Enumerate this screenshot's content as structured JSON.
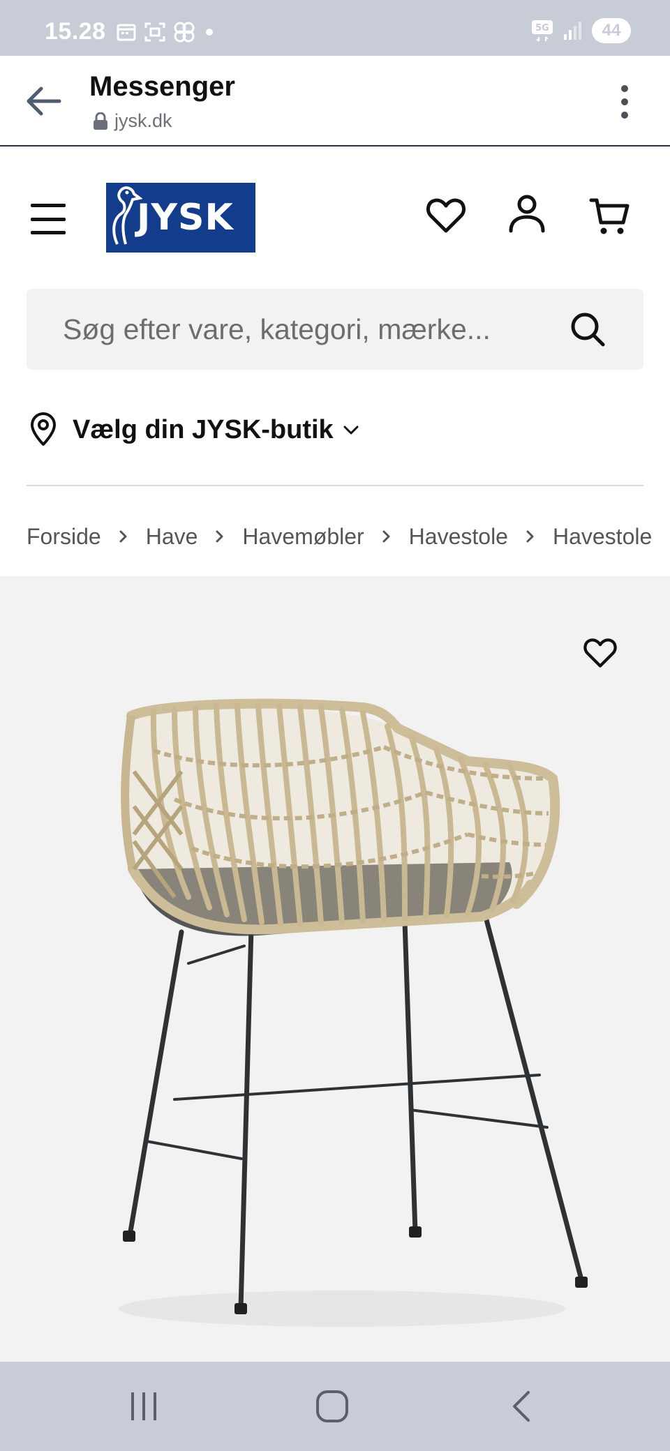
{
  "status_bar": {
    "time": "15.28",
    "network": "5G",
    "battery": "44",
    "icons": [
      "calendar-icon",
      "screenshot-icon",
      "pinwheel-icon",
      "dot-icon",
      "signal-icon"
    ]
  },
  "tab_header": {
    "title": "Messenger",
    "url": "jysk.dk",
    "icons": [
      "back-arrow-icon",
      "lock-icon",
      "more-vert-icon"
    ]
  },
  "site_header": {
    "logo_text": "JYSK",
    "brand_color": "#143c8c",
    "icons": [
      "menu-icon",
      "heart-icon",
      "user-icon",
      "cart-icon"
    ]
  },
  "search": {
    "placeholder": "Søg efter vare, kategori, mærke..."
  },
  "store": {
    "label": "Vælg din JYSK-butik"
  },
  "breadcrumb": {
    "items": [
      "Forside",
      "Have",
      "Havemøbler",
      "Havestole",
      "Havestole"
    ]
  },
  "product": {
    "image_alt": "Rattan havestol med sorte metalben",
    "icons": [
      "wishlist-heart-icon"
    ]
  },
  "nav_bar": {
    "icons": [
      "recent-apps-icon",
      "home-icon",
      "back-icon"
    ]
  }
}
